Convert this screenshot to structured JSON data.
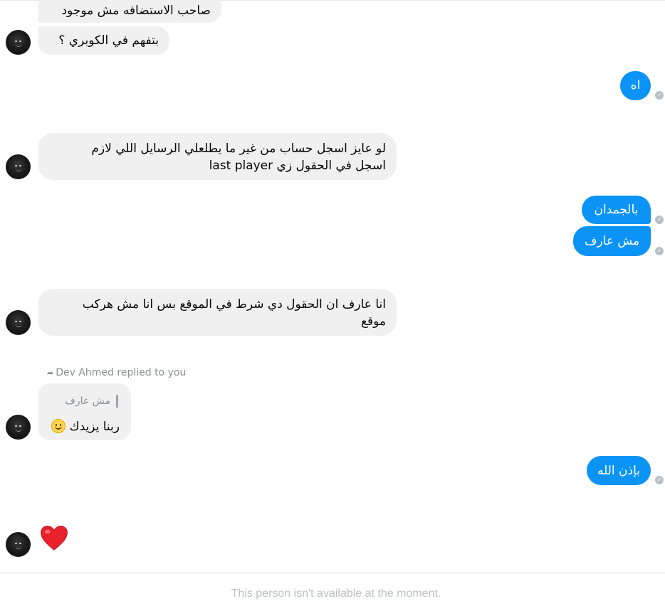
{
  "conversation": {
    "messages_in_1": {
      "line_1": "صاحب الاستضافه مش موجود",
      "line_2": "بتفهم في الكوبري ؟"
    },
    "message_out_1": "اه",
    "message_in_2": {
      "line_1": "لو عايز اسجل حساب من غير ما يطلعلي الرسايل اللي لازم",
      "line_2_ar": "اسجل في الحقول زي ",
      "line_2_en": "last player"
    },
    "message_out_2": "بالجمدان",
    "message_out_3": "مش عارف",
    "message_in_3": {
      "line_1": "انا عارف ان الحقول دي شرط في الموقع بس انا مش هركب",
      "line_2": "موقع"
    },
    "reply": {
      "note": "Dev Ahmed replied to you",
      "quoted": "مش عارف",
      "text": "ربنا يزيدك"
    },
    "message_out_4": "بإذن الله",
    "reaction": "heart-emoji"
  },
  "footer": {
    "status": "This person isn't available at the moment."
  },
  "colors": {
    "outgoing_bubble": "#0b93f6",
    "incoming_bubble": "#f0f0f0",
    "heart": "#e8212b"
  }
}
